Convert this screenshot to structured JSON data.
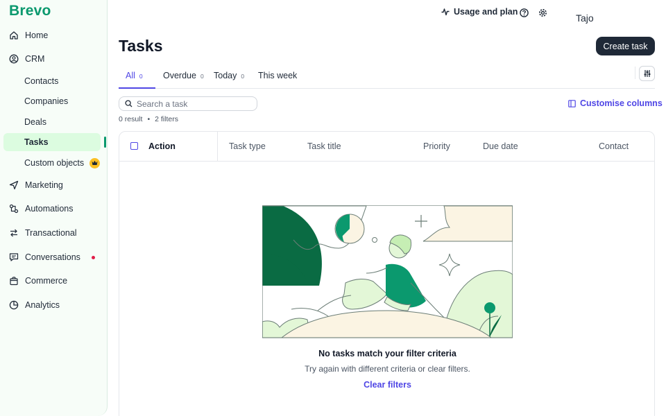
{
  "brand": {
    "logo": "Brevo",
    "accent": "#0b996e"
  },
  "sidebar": {
    "items": [
      {
        "label": "Home",
        "icon": "home-icon"
      },
      {
        "label": "CRM",
        "icon": "user-circle-icon"
      },
      {
        "label": "Contacts"
      },
      {
        "label": "Companies"
      },
      {
        "label": "Deals"
      },
      {
        "label": "Tasks",
        "active": true
      },
      {
        "label": "Custom objects",
        "badge_icon": "crown-icon"
      },
      {
        "label": "Marketing",
        "icon": "send-icon"
      },
      {
        "label": "Automations",
        "icon": "automation-icon"
      },
      {
        "label": "Transactional",
        "icon": "arrows-icon"
      },
      {
        "label": "Conversations",
        "icon": "chat-icon",
        "notification": true
      },
      {
        "label": "Commerce",
        "icon": "bag-icon"
      },
      {
        "label": "Analytics",
        "icon": "pie-chart-icon"
      }
    ]
  },
  "header": {
    "usage_label": "Usage and plan",
    "help_icon": "help-icon",
    "settings_icon": "gear-icon",
    "username": "Tajo"
  },
  "page": {
    "title": "Tasks",
    "create_label": "Create task"
  },
  "tabs": [
    {
      "label": "All",
      "count": "0",
      "active": true
    },
    {
      "label": "Overdue",
      "count": "0"
    },
    {
      "label": "Today",
      "count": "0"
    },
    {
      "label": "This week",
      "count": ""
    }
  ],
  "search": {
    "placeholder": "Search a task",
    "value": ""
  },
  "customise_label": "Customise columns",
  "result": {
    "count": "0 result",
    "separator": "•",
    "filters": "2 filters"
  },
  "table": {
    "columns": [
      "Action",
      "Task type",
      "Task title",
      "Priority",
      "Due date",
      "Contact"
    ]
  },
  "empty": {
    "title": "No tasks match your filter criteria",
    "subtitle": "Try again with different criteria or clear filters.",
    "clear_label": "Clear filters"
  }
}
